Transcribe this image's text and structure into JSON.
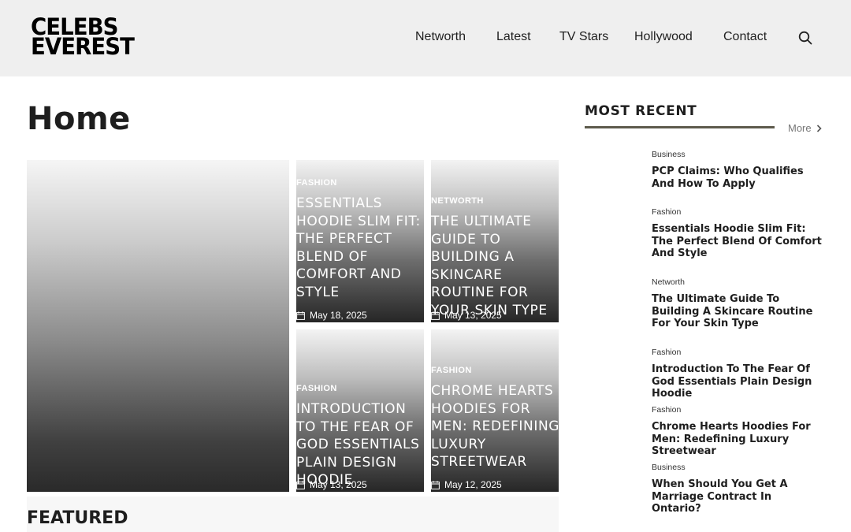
{
  "brand": {
    "line1": "CELEBS",
    "line2": "EVEREST"
  },
  "nav": {
    "items": [
      "Networth",
      "Latest",
      "TV Stars",
      "Hollywood",
      "Contact"
    ]
  },
  "page": {
    "title": "Home",
    "featured_label": "FEATURED"
  },
  "grid": {
    "cards": [
      {
        "category": "FASHION",
        "title": "ESSENTIALS HOODIE SLIM FIT: THE PERFECT BLEND OF COMFORT AND STYLE",
        "date": "May 18, 2025"
      },
      {
        "category": "NETWORTH",
        "title": "THE ULTIMATE GUIDE TO BUILDING A SKINCARE ROUTINE FOR YOUR SKIN TYPE",
        "date": "May 13, 2025"
      },
      {
        "category": "FASHION",
        "title": "INTRODUCTION TO THE FEAR OF GOD ESSENTIALS PLAIN DESIGN HOODIE",
        "date": "May 13, 2025"
      },
      {
        "category": "FASHION",
        "title": "CHROME HEARTS HOODIES FOR MEN: REDEFINING LUXURY STREETWEAR",
        "date": "May 12, 2025"
      }
    ]
  },
  "sidebar": {
    "title": "MOST RECENT",
    "more_label": "More",
    "items": [
      {
        "category": "Business",
        "title": "PCP Claims: Who Qualifies And How To Apply"
      },
      {
        "category": "Fashion",
        "title": "Essentials Hoodie Slim Fit: The Perfect Blend Of Comfort And Style"
      },
      {
        "category": "Networth",
        "title": "The Ultimate Guide To Building A Skincare Routine For Your Skin Type"
      },
      {
        "category": "Fashion",
        "title": "Introduction To The Fear Of God Essentials Plain Design Hoodie"
      },
      {
        "category": "Fashion",
        "title": "Chrome Hearts Hoodies For Men: Redefining Luxury Streetwear"
      },
      {
        "category": "Business",
        "title": "When Should You Get A Marriage Contract In Ontario?"
      }
    ]
  },
  "colors": {
    "header_bg": "#efefef",
    "accent_rule": "#5d5a4c",
    "text": "#1e1e1e"
  },
  "icons": {
    "search": "search-icon",
    "calendar": "calendar-icon",
    "more": "chevron-right-icon"
  }
}
